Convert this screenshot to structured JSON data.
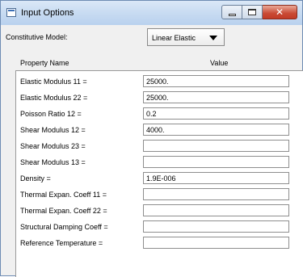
{
  "window": {
    "title": "Input Options"
  },
  "model": {
    "label": "Constitutive Model:",
    "value": "Linear Elastic"
  },
  "grid": {
    "header_name": "Property Name",
    "header_value": "Value",
    "rows": [
      {
        "label": "Elastic Modulus 11 =",
        "value": "25000."
      },
      {
        "label": "Elastic Modulus 22 =",
        "value": "25000."
      },
      {
        "label": "Poisson Ratio 12 =",
        "value": "0.2"
      },
      {
        "label": "Shear Modulus 12 =",
        "value": "4000."
      },
      {
        "label": "Shear Modulus 23 =",
        "value": ""
      },
      {
        "label": "Shear Modulus 13 =",
        "value": ""
      },
      {
        "label": "Density =",
        "value": "1.9E-006"
      },
      {
        "label": "Thermal Expan. Coeff 11 =",
        "value": ""
      },
      {
        "label": "Thermal Expan. Coeff 22 =",
        "value": ""
      },
      {
        "label": "Structural Damping Coeff =",
        "value": ""
      },
      {
        "label": "Reference Temperature =",
        "value": ""
      }
    ]
  },
  "icons": {
    "window": "app-window-icon",
    "minimize": "minimize-icon",
    "maximize": "maximize-icon",
    "close": "close-icon",
    "dropdown": "chevron-down-icon"
  },
  "colors": {
    "titlebar": "#c6daf1",
    "close_button": "#c94a34",
    "background": "#f0f0f0"
  }
}
